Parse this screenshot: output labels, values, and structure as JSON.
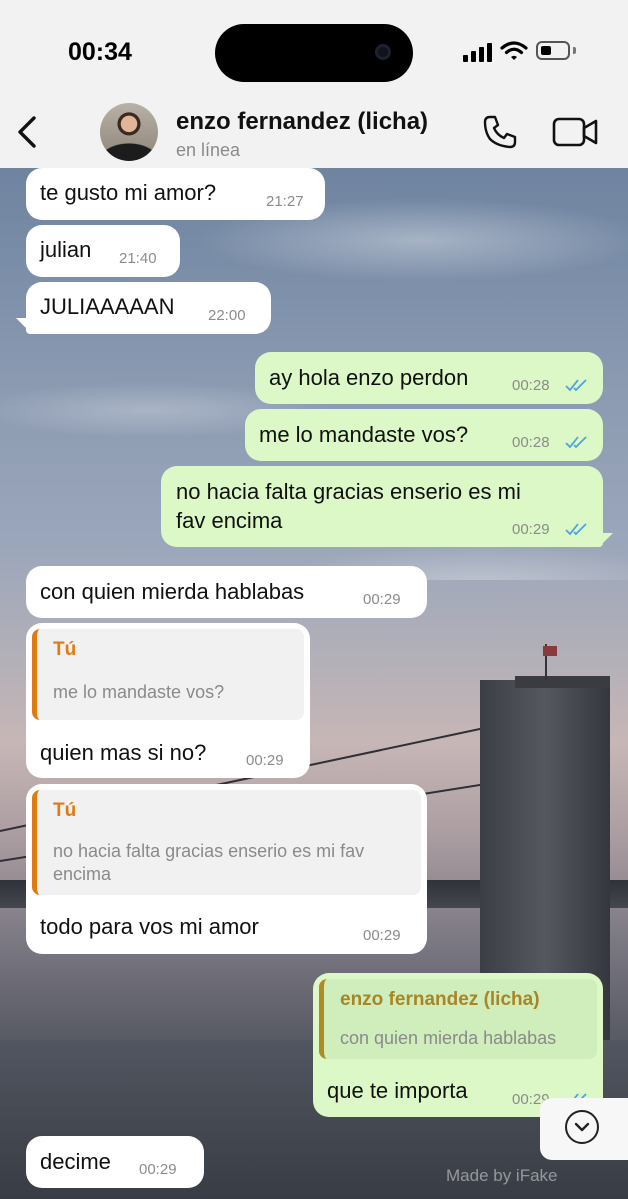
{
  "status_bar": {
    "time": "00:34"
  },
  "header": {
    "contact_name": "enzo fernandez (licha)",
    "contact_status": "en línea"
  },
  "messages": [
    {
      "direction": "in",
      "text": "te gusto mi amor?",
      "time": "21:27"
    },
    {
      "direction": "in",
      "text": "julian",
      "time": "21:40"
    },
    {
      "direction": "in",
      "text": "JULIAAAAAN",
      "time": "22:00"
    },
    {
      "direction": "out",
      "text": "ay hola enzo perdon",
      "time": "00:28",
      "read": true
    },
    {
      "direction": "out",
      "text": "me lo mandaste vos?",
      "time": "00:28",
      "read": true
    },
    {
      "direction": "out",
      "text_line1": "no hacia falta gracias enserio es mi",
      "text_line2": "fav encima",
      "time": "00:29",
      "read": true
    },
    {
      "direction": "in",
      "text": "con quien mierda hablabas",
      "time": "00:29"
    },
    {
      "direction": "in",
      "quote_author": "Tú",
      "quote_text": "me lo mandaste vos?",
      "text": "quien mas si no?",
      "time": "00:29"
    },
    {
      "direction": "in",
      "quote_author": "Tú",
      "quote_line1": "no hacia falta gracias enserio es mi fav",
      "quote_line2": "encima",
      "text": "todo para vos mi amor",
      "time": "00:29"
    },
    {
      "direction": "out",
      "quote_author": "enzo fernandez (licha)",
      "quote_text": "con quien mierda hablabas",
      "text": "que te importa",
      "time": "00:29",
      "read": true
    },
    {
      "direction": "in",
      "text": "decime",
      "time": "00:29"
    }
  ],
  "watermark": "Made by iFake",
  "colors": {
    "incoming": "#ffffff",
    "outgoing": "#dcf8c6",
    "quote_accent_in": "#e07b12",
    "read_ticks": "#4fa3e0"
  },
  "icons": [
    "back-icon",
    "call-icon",
    "video-icon",
    "read-ticks-icon",
    "scroll-down-icon"
  ]
}
